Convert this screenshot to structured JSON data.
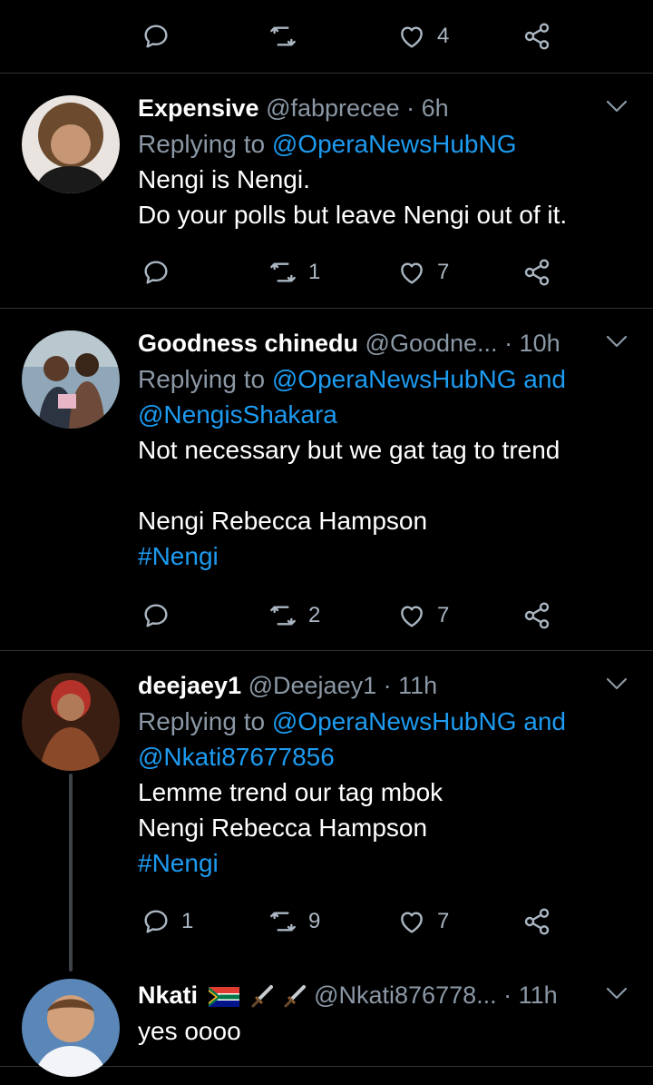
{
  "top_actions": {
    "reply_count": "",
    "retweet_count": "",
    "like_count": "4"
  },
  "tweets": [
    {
      "display_name": "Expensive",
      "handle": "@fabprecee",
      "time": "· 6h",
      "replying_prefix": "Replying to ",
      "replying_to": "@OperaNewsHubNG",
      "replying_and": "",
      "replying_to_2": "",
      "lines": [
        "Nengi is Nengi.",
        "Do your polls but leave Nengi out of it."
      ],
      "reply_count": "",
      "retweet_count": "1",
      "like_count": "7"
    },
    {
      "display_name": "Goodness chinedu",
      "handle": "@Goodne...",
      "time": "· 10h",
      "replying_prefix": "Replying to ",
      "replying_to": "@OperaNewsHubNG",
      "replying_and": "and",
      "replying_to_2": "@NengisShakara",
      "lines": [
        "Not necessary but we gat tag to trend",
        "",
        "Nengi Rebecca Hampson"
      ],
      "hashtag": "#Nengi",
      "reply_count": "",
      "retweet_count": "2",
      "like_count": "7"
    },
    {
      "display_name": "deejaey1",
      "handle": "@Deejaey1",
      "time": "· 11h",
      "replying_prefix": "Replying to ",
      "replying_to": "@OperaNewsHubNG",
      "replying_and": "and",
      "replying_to_2": "@Nkati87677856",
      "lines": [
        "Lemme trend our tag mbok",
        "Nengi Rebecca Hampson"
      ],
      "hashtag": "#Nengi",
      "reply_count": "1",
      "retweet_count": "9",
      "like_count": "7"
    },
    {
      "display_name": "Nkati",
      "emojis": [
        "flag-south-africa-icon",
        "dagger-icon",
        "dagger-icon"
      ],
      "handle": "@Nkati876778...",
      "time": "· 11h",
      "lines": [
        "yes oooo"
      ]
    }
  ]
}
